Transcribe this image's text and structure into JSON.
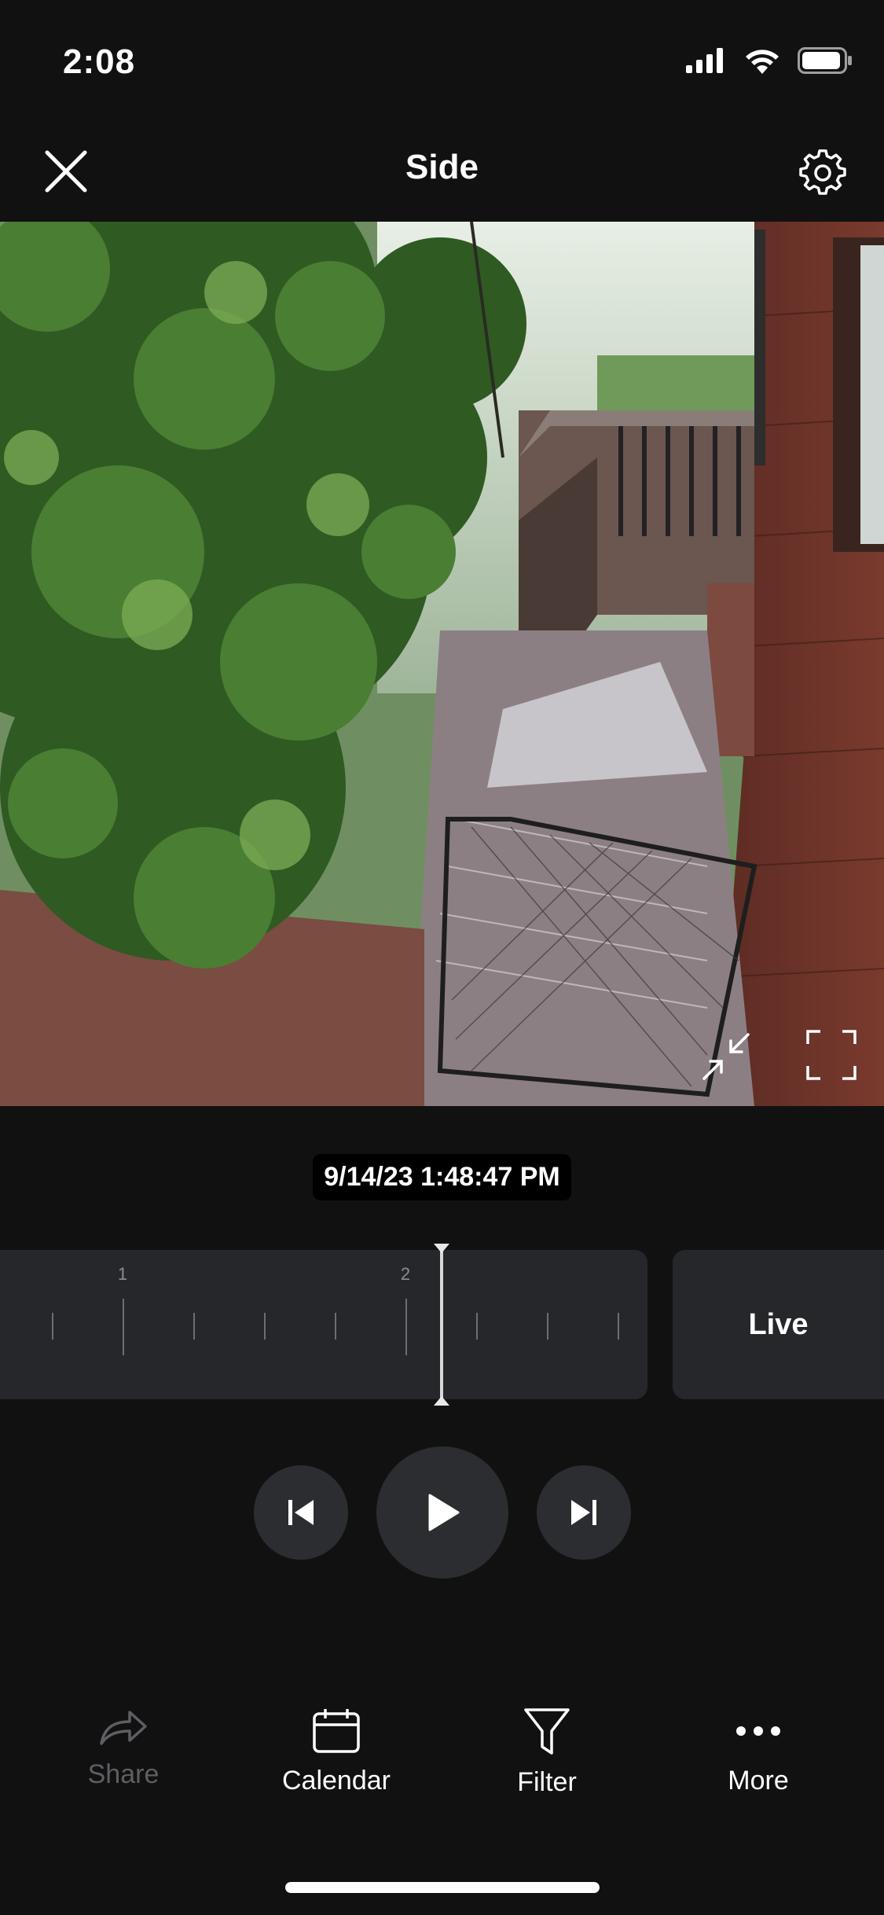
{
  "status_bar": {
    "time": "2:08"
  },
  "header": {
    "title": "Side"
  },
  "video": {
    "camera_name": "Side"
  },
  "playback": {
    "timestamp": "9/14/23 1:48:47 PM",
    "timeline_labels": [
      "1",
      "2"
    ],
    "live_label": "Live"
  },
  "toolbar": {
    "share_label": "Share",
    "calendar_label": "Calendar",
    "filter_label": "Filter",
    "more_label": "More"
  },
  "icons": {
    "close": "close-icon",
    "settings": "gear-icon",
    "exit_fullscreen": "collapse-icon",
    "fullscreen": "fullscreen-icon",
    "previous": "skip-previous-icon",
    "play": "play-icon",
    "next": "skip-next-icon",
    "share": "share-icon",
    "calendar": "calendar-icon",
    "filter": "filter-icon",
    "more": "more-dots-icon"
  },
  "colors": {
    "background": "#111112",
    "panel": "#25272b",
    "control": "#2c2d31",
    "disabled_text": "#5d5f63"
  }
}
